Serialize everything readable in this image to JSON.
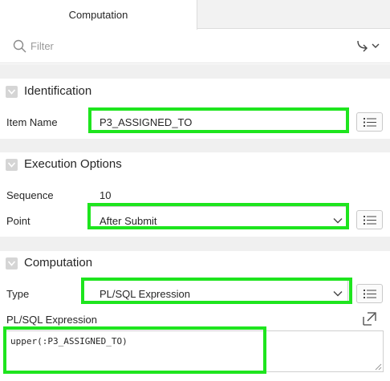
{
  "tabs": {
    "active": "Computation"
  },
  "filter": {
    "placeholder": "Filter"
  },
  "sections": {
    "identification": {
      "title": "Identification",
      "item_name_label": "Item Name",
      "item_name_value": "P3_ASSIGNED_TO"
    },
    "execution": {
      "title": "Execution Options",
      "sequence_label": "Sequence",
      "sequence_value": "10",
      "point_label": "Point",
      "point_value": "After Submit"
    },
    "computation": {
      "title": "Computation",
      "type_label": "Type",
      "type_value": "PL/SQL Expression",
      "expression_label": "PL/SQL Expression",
      "expression_value": "upper(:P3_ASSIGNED_TO)"
    }
  },
  "colors": {
    "highlight": "#1ee51e",
    "gap": "#f0f0f0"
  },
  "icons": [
    "search-icon",
    "goto-arrow-icon",
    "chevron-down-icon",
    "collapse-icon",
    "list-icon",
    "expand-icon"
  ]
}
